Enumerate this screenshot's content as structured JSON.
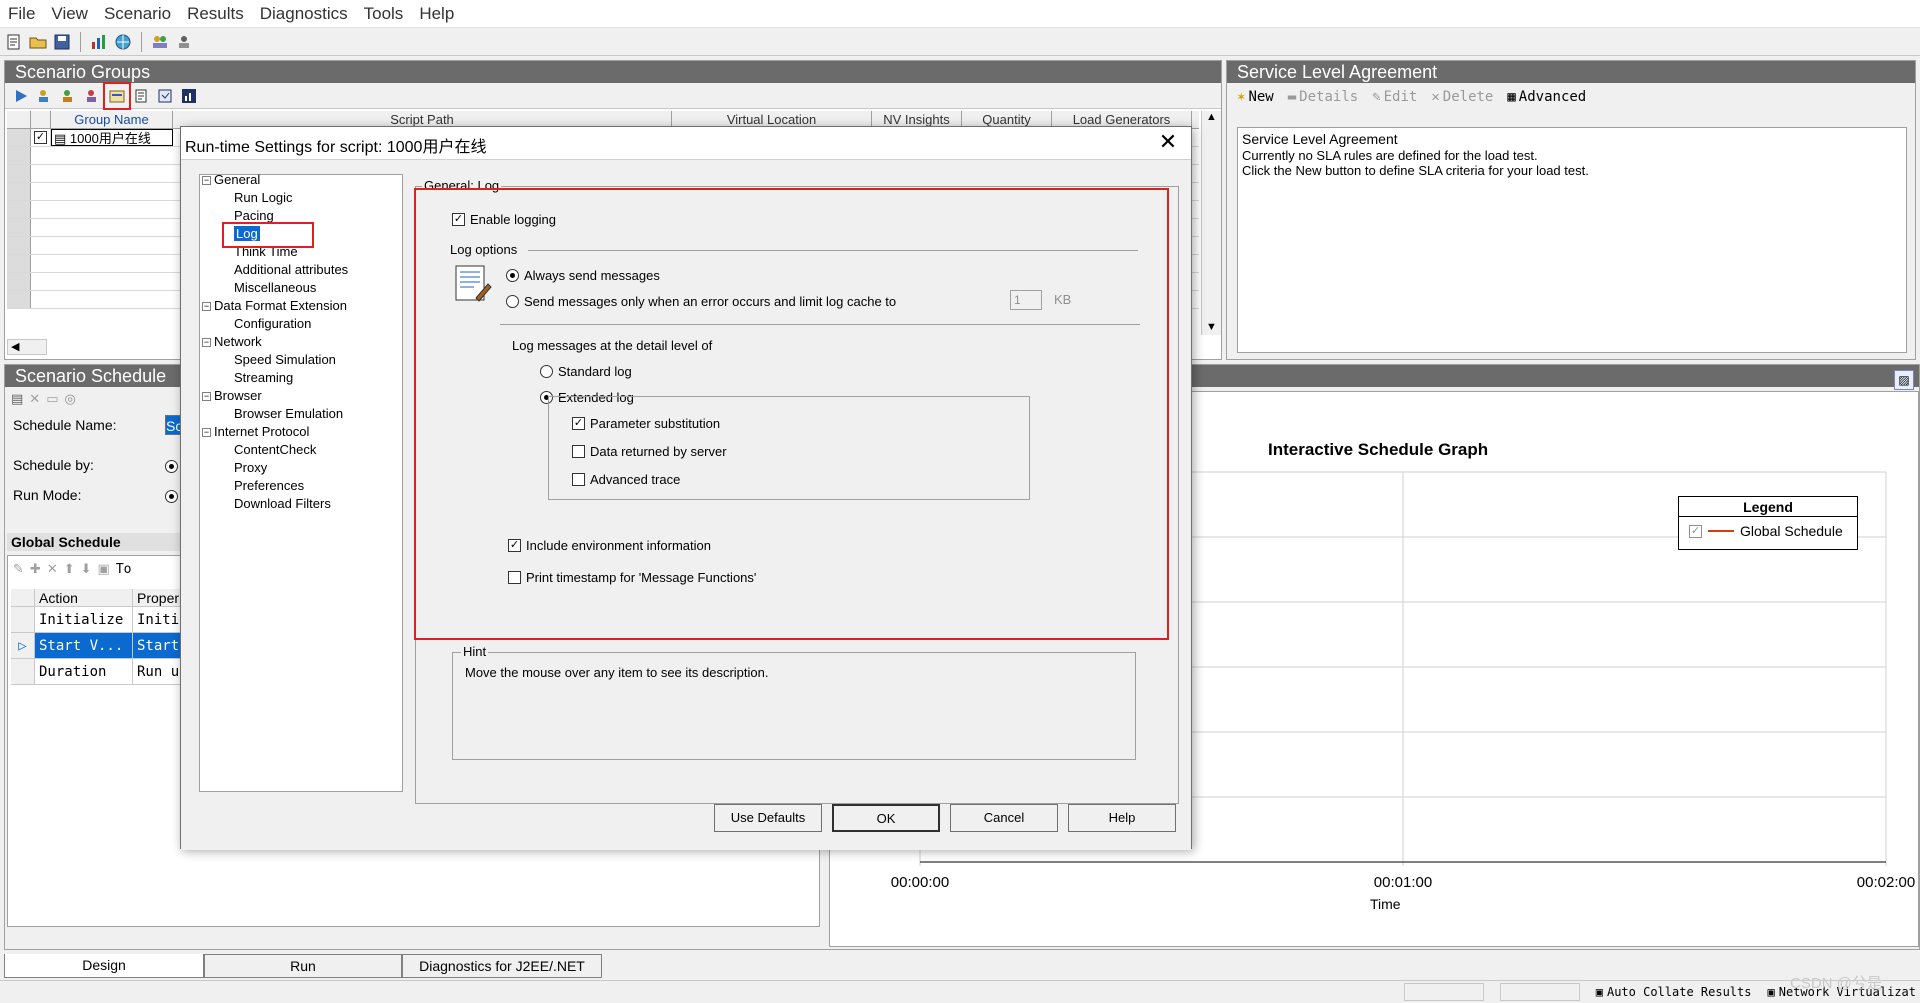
{
  "menu": [
    "File",
    "View",
    "Scenario",
    "Results",
    "Diagnostics",
    "Tools",
    "Help"
  ],
  "scenario_groups": {
    "title": "Scenario Groups",
    "columns": [
      "Group Name",
      "Script Path",
      "Virtual Location",
      "NV Insights",
      "Quantity",
      "Load Generators"
    ],
    "rows": [
      {
        "checked": true,
        "name": "1000用户在线"
      }
    ]
  },
  "sla": {
    "title": "Service Level Agreement",
    "toolbar": {
      "new": "New",
      "details": "Details",
      "edit": "Edit",
      "delete": "Delete",
      "advanced": "Advanced"
    },
    "heading": "Service Level Agreement",
    "line1": "Currently no SLA rules are defined for the load test.",
    "line2": "Click the New button to define SLA criteria for your load test."
  },
  "schedule": {
    "title": "Scenario Schedule",
    "name_label": "Schedule Name:",
    "name_value": "Sc",
    "by_label": "Schedule by:",
    "mode_label": "Run Mode:",
    "global_title": "Global Schedule",
    "gs_toolbar_text": "To",
    "columns": [
      "Action",
      "Proper"
    ],
    "rows": [
      {
        "action": "Initialize",
        "prop": "Initia",
        "selected": false
      },
      {
        "action": "Start  V...",
        "prop": "Start",
        "selected": true
      },
      {
        "action": "Duration",
        "prop": "Run un",
        "selected": false
      }
    ]
  },
  "graph": {
    "title": "Interactive Schedule Graph",
    "xlabel": "Time",
    "ticks": [
      "00:00:00",
      "00:01:00",
      "00:02:00"
    ],
    "legend_title": "Legend",
    "legend_item": "Global Schedule",
    "line_color": "#d04010"
  },
  "dialog": {
    "title": "Run-time Settings for script: 1000用户在线",
    "close": "✕",
    "tree": [
      {
        "label": "General",
        "children": [
          "Run Logic",
          "Pacing",
          "Log",
          "Think Time",
          "Additional attributes",
          "Miscellaneous"
        ]
      },
      {
        "label": "Data Format Extension",
        "children": [
          "Configuration"
        ]
      },
      {
        "label": "Network",
        "children": [
          "Speed Simulation",
          "Streaming"
        ]
      },
      {
        "label": "Browser",
        "children": [
          "Browser Emulation"
        ]
      },
      {
        "label": "Internet Protocol",
        "children": [
          "ContentCheck",
          "Proxy",
          "Preferences",
          "Download Filters"
        ]
      }
    ],
    "selected_node": "Log",
    "section_title": "General: Log",
    "enable_logging": "Enable logging",
    "log_options": "Log options",
    "always_send": "Always send messages",
    "send_on_error": "Send messages only when an error occurs and limit log cache to",
    "cache_value": "1",
    "cache_unit": "KB",
    "detail_level": "Log messages at the detail level of",
    "standard_log": "Standard log",
    "extended_log": "Extended log",
    "param_sub": "Parameter substitution",
    "data_returned": "Data returned by server",
    "advanced_trace": "Advanced trace",
    "include_env": "Include environment information",
    "print_timestamp": "Print timestamp for 'Message Functions'",
    "hint_label": "Hint",
    "hint_text": "Move the mouse over any item to see its description.",
    "buttons": {
      "defaults": "Use Defaults",
      "ok": "OK",
      "cancel": "Cancel",
      "help": "Help"
    }
  },
  "bottom_tabs": [
    "Design",
    "Run",
    "Diagnostics for J2EE/.NET"
  ],
  "status": {
    "auto_collate": "Auto Collate Results",
    "network": "Network Virtualizat"
  },
  "watermark": "CSDN @兮是"
}
